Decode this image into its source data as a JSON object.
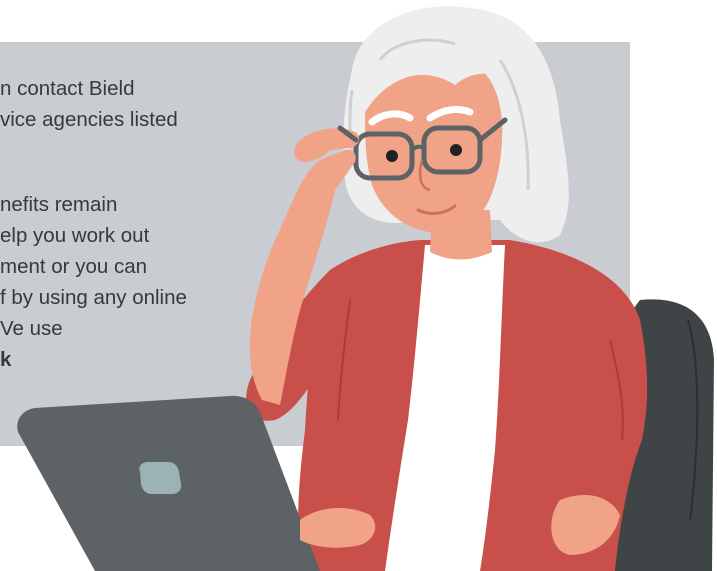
{
  "body_text": {
    "lines": [
      "n contact Bield",
      "vice agencies listed",
      "nefits remain",
      "elp you work out",
      "ment or you can",
      "f by using any online",
      "Ve use",
      "k"
    ]
  },
  "colors": {
    "panel": "#c9ccd0",
    "text": "#333a40",
    "cardigan": "#c9504a",
    "skin": "#f0a387",
    "hair": "#eeeeee",
    "laptop": "#5d6266",
    "chair": "#3f4447"
  }
}
